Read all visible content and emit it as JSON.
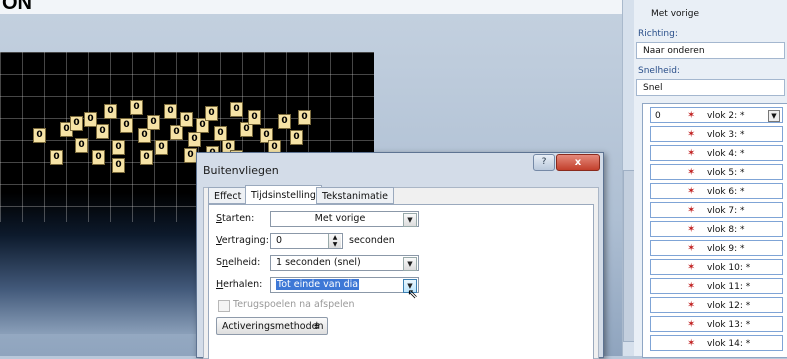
{
  "page_fragment": "ON",
  "colors": {
    "accent": "#3366cc",
    "dialog_bg": "#d3dce8",
    "pane_bg": "#e9eff6",
    "close_red": "#c2402c"
  },
  "right_pane": {
    "start_value": "Met vorige",
    "direction_label": "Richting:",
    "direction_value": "Naar onderen",
    "speed_label": "Snelheid:",
    "speed_value": "Snel",
    "list_first_num": "0",
    "list": [
      {
        "label": "vlok 2: *"
      },
      {
        "label": "vlok 3: *"
      },
      {
        "label": "vlok 4: *"
      },
      {
        "label": "vlok 5: *"
      },
      {
        "label": "vlok 6: *"
      },
      {
        "label": "vlok 7: *"
      },
      {
        "label": "vlok 8: *"
      },
      {
        "label": "vlok 9: *"
      },
      {
        "label": "vlok 10: *"
      },
      {
        "label": "vlok 11: *"
      },
      {
        "label": "vlok 12: *"
      },
      {
        "label": "vlok 13: *"
      },
      {
        "label": "vlok 14: *"
      }
    ],
    "icon_name": "star-animation-icon"
  },
  "slide": {
    "flake_text": "0"
  },
  "dialog": {
    "title": "Buitenvliegen",
    "help_label": "?",
    "close_label": "x",
    "tabs": [
      "Effect",
      "Tijdsinstelling",
      "Tekstanimatie"
    ],
    "active_tab": "Tijdsinstelling",
    "start_label": "Starten:",
    "start_value": "Met vorige",
    "delay_label": "Vertraging:",
    "delay_value": "0",
    "delay_unit": "seconden",
    "speed_label": "Snelheid:",
    "speed_value": "1 seconden (snel)",
    "repeat_label": "Herhalen:",
    "repeat_value": "Tot einde van dia",
    "rewind_label": "Terugspoelen na afspelen",
    "triggers_label": "Activeringsmethoden"
  }
}
